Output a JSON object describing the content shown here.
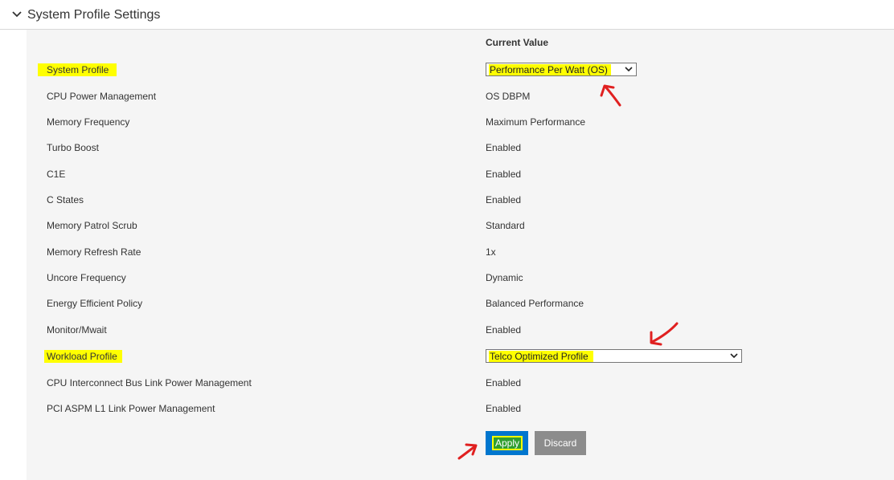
{
  "section": {
    "title": "System Profile Settings"
  },
  "table": {
    "current_value_header": "Current Value",
    "rows": [
      {
        "label": "System Profile",
        "value": "Performance Per Watt (OS)"
      },
      {
        "label": "CPU Power Management",
        "value": "OS DBPM"
      },
      {
        "label": "Memory Frequency",
        "value": "Maximum Performance"
      },
      {
        "label": "Turbo Boost",
        "value": "Enabled"
      },
      {
        "label": "C1E",
        "value": "Enabled"
      },
      {
        "label": "C States",
        "value": "Enabled"
      },
      {
        "label": "Memory Patrol Scrub",
        "value": "Standard"
      },
      {
        "label": "Memory Refresh Rate",
        "value": "1x"
      },
      {
        "label": "Uncore Frequency",
        "value": "Dynamic"
      },
      {
        "label": "Energy Efficient Policy",
        "value": "Balanced Performance"
      },
      {
        "label": "Monitor/Mwait",
        "value": "Enabled"
      },
      {
        "label": "Workload Profile",
        "value": "Telco Optimized Profile"
      },
      {
        "label": "CPU Interconnect Bus Link Power Management",
        "value": "Enabled"
      },
      {
        "label": "PCI ASPM L1 Link Power Management",
        "value": "Enabled"
      }
    ]
  },
  "buttons": {
    "apply": "Apply",
    "discard": "Discard"
  },
  "icons": {
    "section_toggle": "chevron-down-icon",
    "select_caret": "chevron-down-icon",
    "annotation": "red-arrow-icon"
  },
  "colors": {
    "highlight": "#ffff00",
    "annotation_arrow": "#e02020",
    "apply_button": "#0076ce",
    "discard_button": "#8c8c8c",
    "panel_background": "#f5f5f5"
  }
}
